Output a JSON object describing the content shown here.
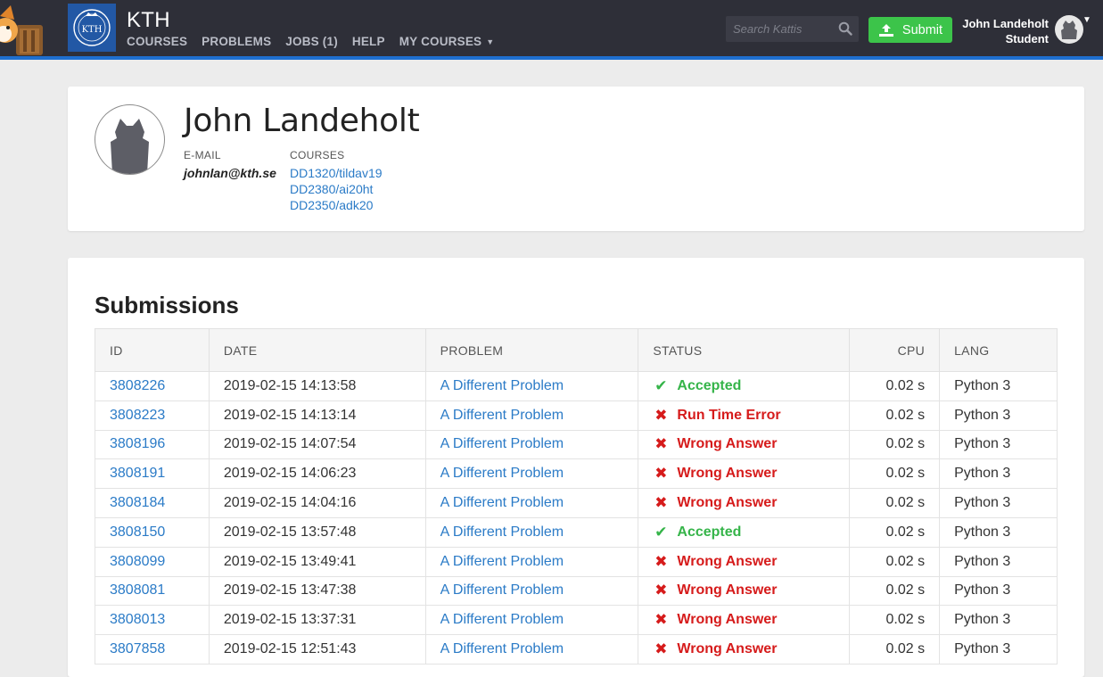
{
  "header": {
    "site_title": "KTH",
    "nav": [
      {
        "label": "COURSES"
      },
      {
        "label": "PROBLEMS"
      },
      {
        "label": "JOBS (1)"
      },
      {
        "label": "HELP"
      },
      {
        "label": "MY COURSES",
        "has_dropdown": true
      }
    ],
    "search_placeholder": "Search Kattis",
    "submit_label": "Submit",
    "user_name": "John Landeholt",
    "user_role": "Student",
    "icons": {
      "search": "search-icon",
      "submit": "upload-icon",
      "menu": "caret-down-icon"
    }
  },
  "profile": {
    "name": "John Landeholt",
    "email_label": "E-MAIL",
    "email": "johnlan@kth.se",
    "courses_label": "COURSES",
    "courses": [
      "DD1320/tildav19",
      "DD2380/ai20ht",
      "DD2350/adk20"
    ]
  },
  "submissions": {
    "title": "Submissions",
    "columns": {
      "id": "ID",
      "date": "DATE",
      "problem": "PROBLEM",
      "status": "STATUS",
      "cpu": "CPU",
      "lang": "LANG"
    },
    "rows": [
      {
        "id": "3808226",
        "date": "2019-02-15 14:13:58",
        "problem": "A Different Problem",
        "status": "Accepted",
        "ok": true,
        "cpu": "0.02 s",
        "lang": "Python 3"
      },
      {
        "id": "3808223",
        "date": "2019-02-15 14:13:14",
        "problem": "A Different Problem",
        "status": "Run Time Error",
        "ok": false,
        "cpu": "0.02 s",
        "lang": "Python 3"
      },
      {
        "id": "3808196",
        "date": "2019-02-15 14:07:54",
        "problem": "A Different Problem",
        "status": "Wrong Answer",
        "ok": false,
        "cpu": "0.02 s",
        "lang": "Python 3"
      },
      {
        "id": "3808191",
        "date": "2019-02-15 14:06:23",
        "problem": "A Different Problem",
        "status": "Wrong Answer",
        "ok": false,
        "cpu": "0.02 s",
        "lang": "Python 3"
      },
      {
        "id": "3808184",
        "date": "2019-02-15 14:04:16",
        "problem": "A Different Problem",
        "status": "Wrong Answer",
        "ok": false,
        "cpu": "0.02 s",
        "lang": "Python 3"
      },
      {
        "id": "3808150",
        "date": "2019-02-15 13:57:48",
        "problem": "A Different Problem",
        "status": "Accepted",
        "ok": true,
        "cpu": "0.02 s",
        "lang": "Python 3"
      },
      {
        "id": "3808099",
        "date": "2019-02-15 13:49:41",
        "problem": "A Different Problem",
        "status": "Wrong Answer",
        "ok": false,
        "cpu": "0.02 s",
        "lang": "Python 3"
      },
      {
        "id": "3808081",
        "date": "2019-02-15 13:47:38",
        "problem": "A Different Problem",
        "status": "Wrong Answer",
        "ok": false,
        "cpu": "0.02 s",
        "lang": "Python 3"
      },
      {
        "id": "3808013",
        "date": "2019-02-15 13:37:31",
        "problem": "A Different Problem",
        "status": "Wrong Answer",
        "ok": false,
        "cpu": "0.02 s",
        "lang": "Python 3"
      },
      {
        "id": "3807858",
        "date": "2019-02-15 12:51:43",
        "problem": "A Different Problem",
        "status": "Wrong Answer",
        "ok": false,
        "cpu": "0.02 s",
        "lang": "Python 3"
      }
    ]
  },
  "colors": {
    "topbar": "#2e2f38",
    "accent_line": "#1e6fd0",
    "link": "#2b7bc7",
    "accepted": "#35b449",
    "error": "#d61b1b",
    "submit_button": "#3cc44a"
  }
}
